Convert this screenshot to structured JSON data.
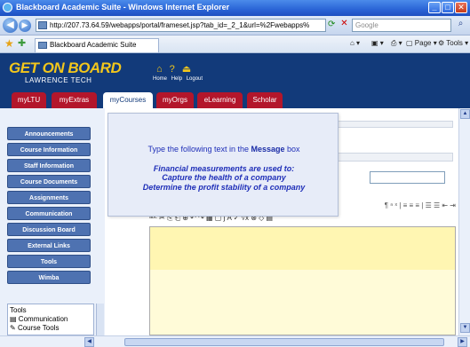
{
  "window": {
    "title": "Blackboard Academic Suite - Windows Internet Explorer",
    "controls": {
      "minimize": "_",
      "maximize": "□",
      "close": "✕"
    }
  },
  "address_bar": {
    "url": "http://207.73.64.59/webapps/portal/frameset.jsp?tab_id=_2_1&url=%2Fwebapps%",
    "search_placeholder": "Google"
  },
  "favorites_bar": {
    "tab_label": "Blackboard Academic Suite",
    "tools": {
      "page": "Page",
      "tools": "Tools"
    }
  },
  "header": {
    "logo_line1": "GET ON BOARD",
    "logo_line2": "LAWRENCE TECH",
    "links": [
      "Home",
      "Help",
      "Logout"
    ],
    "icons": [
      "home-icon",
      "help-icon",
      "logout-icon"
    ]
  },
  "tabs": [
    {
      "label": "myLTU",
      "active": false
    },
    {
      "label": "myExtras",
      "active": false
    },
    {
      "label": "myCourses",
      "active": true
    },
    {
      "label": "myOrgs",
      "active": false
    },
    {
      "label": "eLearning",
      "active": false
    },
    {
      "label": "Scholar",
      "active": false
    }
  ],
  "course_menu": [
    "Announcements",
    "Course Information",
    "Staff Information",
    "Course Documents",
    "Assignments",
    "Communication",
    "Discussion Board",
    "External Links",
    "Tools",
    "Wimba"
  ],
  "tools_box": {
    "title": "Tools",
    "items": [
      "Communication",
      "Course Tools"
    ]
  },
  "instruction": {
    "prefix": "Type the following text in the ",
    "emphasis": "Message",
    "suffix": " box",
    "quote": [
      "Financial measurements are used to:",
      "Capture the health of a company",
      "Determine the profit stability of a company"
    ]
  },
  "colors": {
    "header_blue": "#123a7a",
    "tab_red": "#b3162b",
    "logo_gold": "#f2c61c",
    "menu_button": "#4e72b1",
    "instruction_text": "#1f2fb8",
    "editor_yellow": "#fffbd8"
  }
}
